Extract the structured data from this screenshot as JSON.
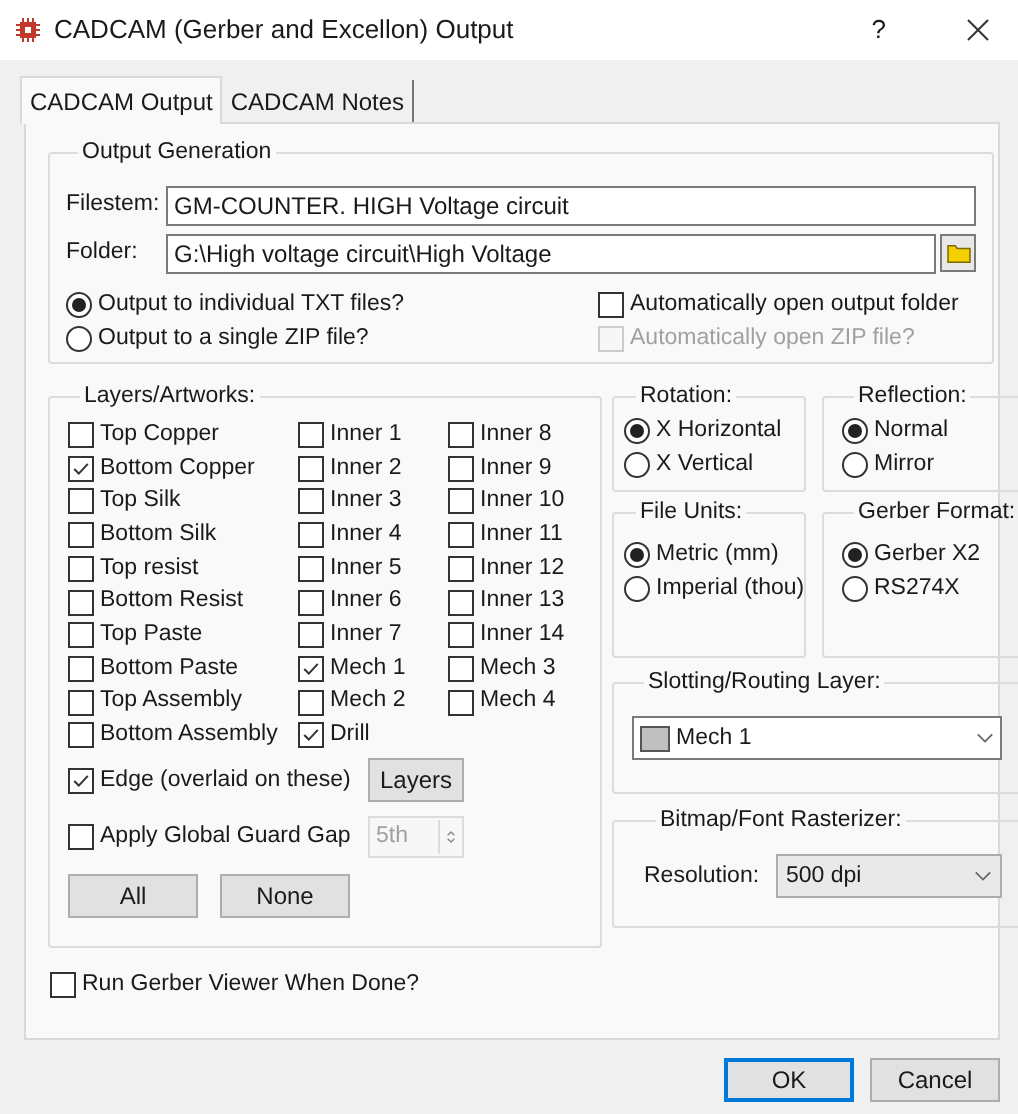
{
  "window": {
    "title": "CADCAM (Gerber and Excellon) Output",
    "help": "?"
  },
  "tabs": [
    {
      "label": "CADCAM Output",
      "selected": true
    },
    {
      "label": "CADCAM Notes",
      "selected": false
    }
  ],
  "output_generation": {
    "title": "Output Generation",
    "filestem": {
      "label": "Filestem:",
      "value": "GM-COUNTER. HIGH Voltage circuit"
    },
    "folder": {
      "label": "Folder:",
      "value": "G:\\High voltage circuit\\High Voltage"
    },
    "output_mode": [
      {
        "label": "Output to individual TXT files?",
        "selected": true
      },
      {
        "label": "Output to a single ZIP file?",
        "selected": false
      }
    ],
    "auto_open": [
      {
        "label": "Automatically open output folder",
        "checked": false,
        "disabled": false
      },
      {
        "label": "Automatically open ZIP file?",
        "checked": false,
        "disabled": true
      }
    ]
  },
  "layers": {
    "title": "Layers/Artworks:",
    "columns": [
      [
        {
          "label": "Top Copper",
          "checked": false
        },
        {
          "label": "Bottom Copper",
          "checked": true
        },
        {
          "label": "Top Silk",
          "checked": false
        },
        {
          "label": "Bottom Silk",
          "checked": false
        },
        {
          "label": "Top resist",
          "checked": false
        },
        {
          "label": "Bottom Resist",
          "checked": false
        },
        {
          "label": "Top Paste",
          "checked": false
        },
        {
          "label": "Bottom Paste",
          "checked": false
        },
        {
          "label": "Top Assembly",
          "checked": false
        },
        {
          "label": "Bottom Assembly",
          "checked": false
        }
      ],
      [
        {
          "label": "Inner 1",
          "checked": false
        },
        {
          "label": "Inner 2",
          "checked": false
        },
        {
          "label": "Inner 3",
          "checked": false
        },
        {
          "label": "Inner 4",
          "checked": false
        },
        {
          "label": "Inner 5",
          "checked": false
        },
        {
          "label": "Inner 6",
          "checked": false
        },
        {
          "label": "Inner 7",
          "checked": false
        },
        {
          "label": "Mech 1",
          "checked": true
        },
        {
          "label": "Mech 2",
          "checked": false
        },
        {
          "label": "Drill",
          "checked": true
        }
      ],
      [
        {
          "label": "Inner 8",
          "checked": false
        },
        {
          "label": "Inner 9",
          "checked": false
        },
        {
          "label": "Inner 10",
          "checked": false
        },
        {
          "label": "Inner 11",
          "checked": false
        },
        {
          "label": "Inner 12",
          "checked": false
        },
        {
          "label": "Inner 13",
          "checked": false
        },
        {
          "label": "Inner 14",
          "checked": false
        },
        {
          "label": "Mech 3",
          "checked": false
        },
        {
          "label": "Mech 4",
          "checked": false
        }
      ]
    ],
    "edge": {
      "label": "Edge (overlaid on these)",
      "checked": true
    },
    "layers_button": "Layers",
    "guard_gap": {
      "label": "Apply Global Guard Gap",
      "checked": false,
      "value": "5th",
      "disabled": true
    },
    "buttons": [
      "All",
      "None"
    ]
  },
  "rotation": {
    "title": "Rotation:",
    "options": [
      {
        "label": "X Horizontal",
        "selected": true
      },
      {
        "label": "X Vertical",
        "selected": false
      }
    ]
  },
  "reflection": {
    "title": "Reflection:",
    "options": [
      {
        "label": "Normal",
        "selected": true
      },
      {
        "label": "Mirror",
        "selected": false
      }
    ]
  },
  "file_units": {
    "title": "File Units:",
    "options": [
      {
        "label": "Metric (mm)",
        "selected": true
      },
      {
        "label": "Imperial (thou)",
        "selected": false
      }
    ]
  },
  "gerber_format": {
    "title": "Gerber Format:",
    "options": [
      {
        "label": "Gerber X2",
        "selected": true
      },
      {
        "label": "RS274X",
        "selected": false
      }
    ]
  },
  "slotting": {
    "title": "Slotting/Routing Layer:",
    "value": "Mech 1"
  },
  "bitmap": {
    "title": "Bitmap/Font Rasterizer:",
    "label": "Resolution:",
    "value": "500 dpi"
  },
  "run_viewer": {
    "label": "Run Gerber Viewer When Done?",
    "checked": false
  },
  "buttons": [
    {
      "label": "OK",
      "default": true
    },
    {
      "label": "Cancel",
      "default": false
    }
  ]
}
